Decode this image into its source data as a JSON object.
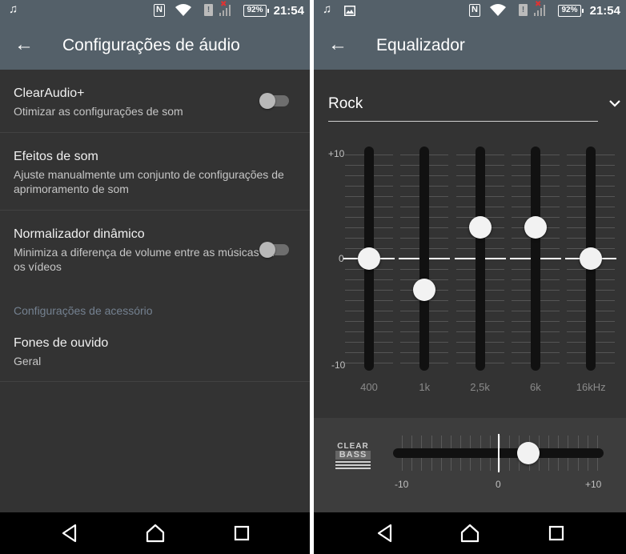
{
  "status": {
    "time": "21:54",
    "battery": "92%",
    "nfc": "N"
  },
  "settings_screen": {
    "title": "Configurações de áudio",
    "items": [
      {
        "title": "ClearAudio+",
        "subtitle": "Otimizar as configurações de som",
        "toggle": false
      },
      {
        "title": "Efeitos de som",
        "subtitle": "Ajuste manualmente um conjunto de configurações de aprimoramento de som"
      },
      {
        "title": "Normalizador dinâmico",
        "subtitle": "Minimiza a diferença de volume entre as músicas ou os vídeos",
        "toggle": false
      }
    ],
    "section_header": "Configurações de acessório",
    "accessory": {
      "title": "Fones de ouvido",
      "subtitle": "Geral"
    }
  },
  "equalizer_screen": {
    "title": "Equalizador",
    "preset": "Rock",
    "scale": {
      "max": "+10",
      "zero": "0",
      "min": "-10"
    },
    "bands": [
      {
        "label": "400",
        "value": 0
      },
      {
        "label": "1k",
        "value": -3
      },
      {
        "label": "2,5k",
        "value": 3
      },
      {
        "label": "6k",
        "value": 3
      },
      {
        "label": "16kHz",
        "value": 0
      }
    ],
    "clear_bass": {
      "logo_top": "CLEAR",
      "logo_bottom": "BASS",
      "value": 3,
      "min_label": "-10",
      "zero_label": "0",
      "max_label": "+10"
    }
  },
  "icons": {
    "music": "music-note-icon",
    "image": "image-icon",
    "back": "arrow-back-icon",
    "dropdown": "chevron-down-icon",
    "nav_back": "nav-back-icon",
    "nav_home": "nav-home-icon",
    "nav_recent": "nav-recent-icon"
  },
  "colors": {
    "appbar": "#546069",
    "background": "#333333",
    "section_header": "#748190"
  }
}
